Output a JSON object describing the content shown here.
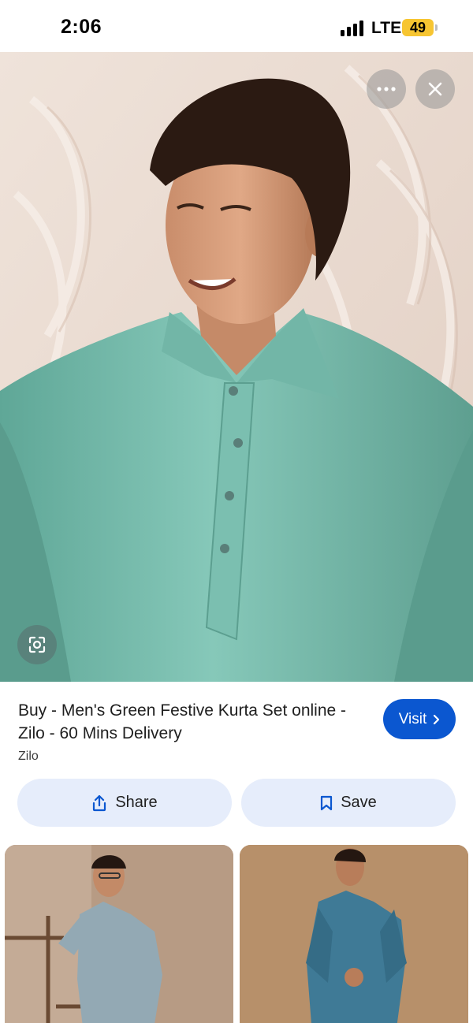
{
  "status_bar": {
    "time": "2:06",
    "network": "LTE",
    "battery": "49",
    "battery_color": "#f7c531"
  },
  "hero": {
    "more_icon": "more-horizontal-icon",
    "close_icon": "close-icon",
    "lens_icon": "lens-search-icon"
  },
  "result": {
    "title": "Buy - Men's Green Festive Kurta Set online - Zilo - 60 Mins Delivery",
    "source": "Zilo",
    "visit_label": "Visit",
    "visit_color": "#0b57d0"
  },
  "actions": {
    "share_label": "Share",
    "save_label": "Save",
    "button_bg": "#e6edfb"
  },
  "colors": {
    "kurta_green": "#7cc2b4",
    "thumb_kurta_grey": "#93a9b4",
    "thumb_kurta_blue": "#3f7a96"
  }
}
